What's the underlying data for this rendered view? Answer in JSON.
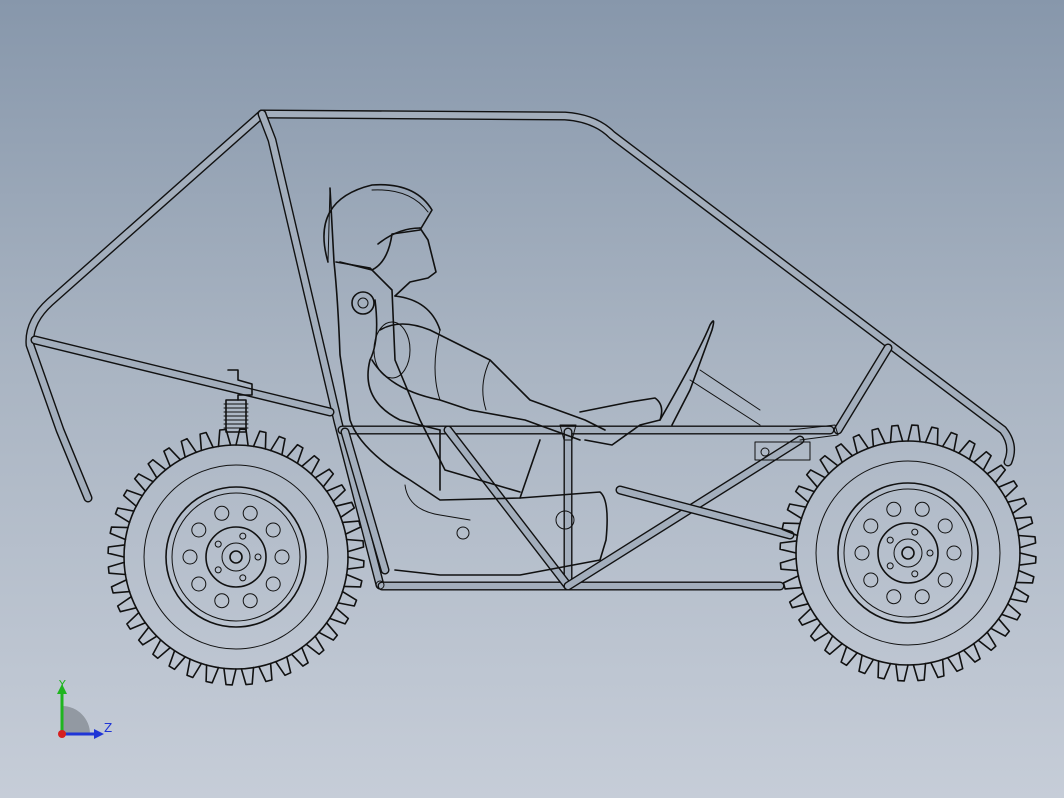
{
  "viewport": {
    "background_top": "#8797ab",
    "background_bottom": "#c6cdd8",
    "line_color": "#111111"
  },
  "model": {
    "parts": [
      "roll-cage",
      "driver",
      "steering-wheel",
      "seat",
      "front-wheel",
      "rear-wheel",
      "shock-absorber"
    ]
  },
  "triad": {
    "y_label": "Y",
    "z_label": "Z",
    "y_color": "#1fb51f",
    "z_color": "#1f35d6",
    "x_color": "#d62020"
  }
}
